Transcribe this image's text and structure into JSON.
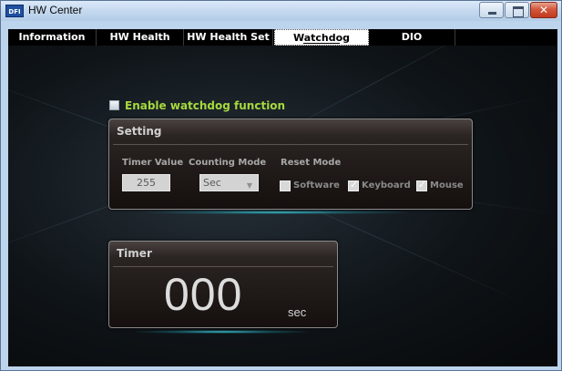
{
  "window": {
    "icon_text": "DFI",
    "title": "HW Center"
  },
  "tabs": [
    {
      "label": "Information",
      "active": false
    },
    {
      "label": "HW Health",
      "active": false
    },
    {
      "label": "HW Health Set",
      "active": false
    },
    {
      "label": "Watchdog",
      "active": true
    },
    {
      "label": "DIO",
      "active": false
    }
  ],
  "watchdog": {
    "enable_label": "Enable watchdog function",
    "enabled": false
  },
  "setting": {
    "title": "Setting",
    "timer_value_label": "Timer Value",
    "counting_mode_label": "Counting Mode",
    "reset_mode_label": "Reset Mode",
    "timer_value": "255",
    "counting_mode": "Sec",
    "reset_options": [
      {
        "label": "Software",
        "checked": false
      },
      {
        "label": "Keyboard",
        "checked": true
      },
      {
        "label": "Mouse",
        "checked": true
      }
    ]
  },
  "timer": {
    "title": "Timer",
    "value": "000",
    "unit": "sec"
  },
  "colors": {
    "enable_label": "#a6d93e",
    "glow": "#46dce6",
    "panel_bg": "#1a1412"
  }
}
